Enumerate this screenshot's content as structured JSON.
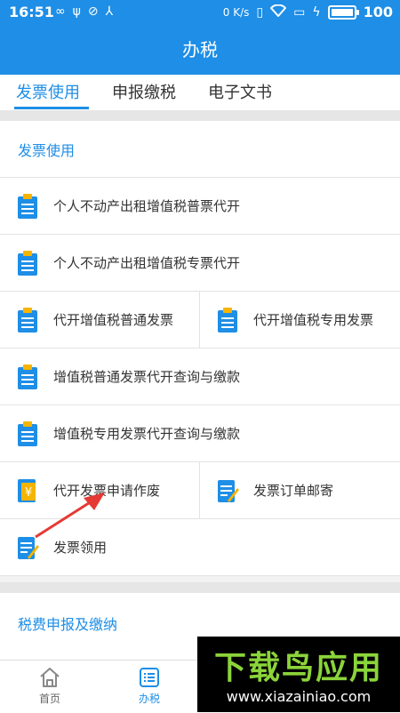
{
  "status_bar": {
    "time": "16:51",
    "left_icons": [
      "infinity-icon",
      "usb-icon",
      "check-circle-icon",
      "share-icon"
    ],
    "net_speed": "0 K/s",
    "battery_percent": "100",
    "battery_level": 1.0
  },
  "header": {
    "title": "办税"
  },
  "tabs": [
    {
      "label": "发票使用",
      "active": true
    },
    {
      "label": "申报缴税",
      "active": false
    },
    {
      "label": "电子文书",
      "active": false
    }
  ],
  "sections": [
    {
      "title": "发票使用"
    },
    {
      "title": "税费申报及缴纳"
    }
  ],
  "invoice_items": {
    "row1": {
      "label": "个人不动产出租增值税普票代开",
      "icon": "clipboard-icon"
    },
    "row2": {
      "label": "个人不动产出租增值税专票代开",
      "icon": "clipboard-icon"
    },
    "row3_left": {
      "label": "代开增值税普通发票",
      "icon": "clipboard-icon"
    },
    "row3_right": {
      "label": "代开增值税专用发票",
      "icon": "clipboard-icon"
    },
    "row4": {
      "label": "增值税普通发票代开查询与缴款",
      "icon": "clipboard-icon"
    },
    "row5": {
      "label": "增值税专用发票代开查询与缴款",
      "icon": "clipboard-icon"
    },
    "row6_left": {
      "label": "代开发票申请作废",
      "icon": "yuan-document-icon"
    },
    "row6_right": {
      "label": "发票订单邮寄",
      "icon": "edit-document-icon"
    },
    "row7": {
      "label": "发票领用",
      "icon": "edit-document-icon"
    }
  },
  "bottom_nav": [
    {
      "label": "首页",
      "icon": "home-icon",
      "active": false
    },
    {
      "label": "办税",
      "icon": "list-icon",
      "active": true
    }
  ],
  "watermark": {
    "logo": "下载鸟应用",
    "url": "www.xiazainiao.com"
  },
  "colors": {
    "primary": "#1e8ee6",
    "icon_yellow": "#f5b400",
    "arrow_red": "#e53935"
  }
}
